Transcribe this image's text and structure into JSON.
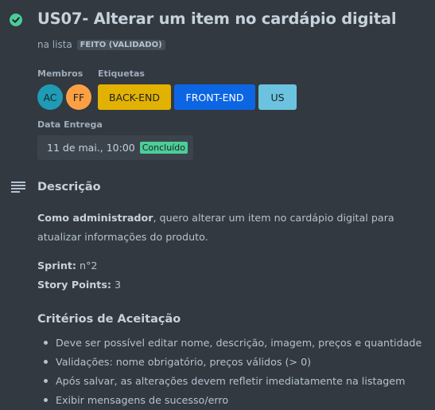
{
  "card": {
    "title": "US07- Alterar um item no cardápio digital",
    "list_prefix": "na lista",
    "list_name": "FEITO (VALIDADO)"
  },
  "members": {
    "label": "Membros",
    "items": [
      {
        "initials": "AC",
        "color": "#1f9bb5"
      },
      {
        "initials": "FF",
        "color": "#fca043"
      }
    ]
  },
  "labels": {
    "label": "Etiquetas",
    "items": [
      {
        "text": "BACK-END",
        "color": "#e2b203"
      },
      {
        "text": "FRONT-END",
        "color": "#0c66e4"
      },
      {
        "text": "US",
        "color": "#6cc3e0"
      }
    ]
  },
  "due_date": {
    "label": "Data Entrega",
    "value": "11 de mai., 10:00",
    "status": "Concluído"
  },
  "description": {
    "heading": "Descrição",
    "intro_bold": "Como administrador",
    "intro_rest": ", quero alterar um item no cardápio digital para atualizar informações do produto.",
    "sprint_label": "Sprint:",
    "sprint_value": " n°2",
    "points_label": "Story Points:",
    "points_value": " 3"
  },
  "criteria": {
    "heading": "Critérios de Aceitação",
    "items": [
      "Deve ser possível editar nome, descrição, imagem, preços e quantidade",
      "Validações: nome obrigatório, preços válidos (> 0)",
      "Após salvar, as alterações devem refletir imediatamente na listagem",
      "Exibir mensagens de sucesso/erro"
    ]
  }
}
